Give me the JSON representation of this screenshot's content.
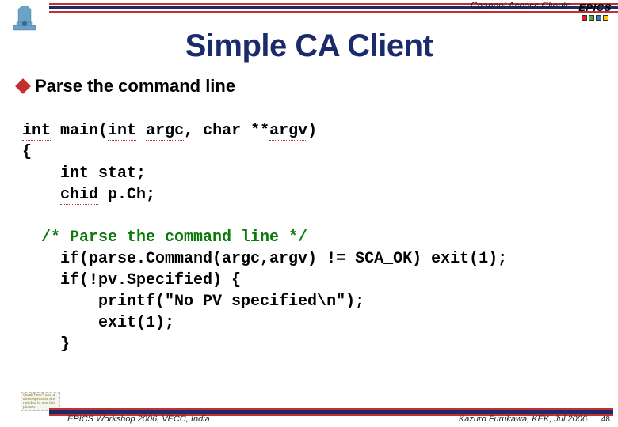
{
  "header": {
    "caption": "Channel Access Clients",
    "logo_text": "EPICS",
    "block_colors": [
      "#e41a1c",
      "#4daf4a",
      "#377eb8",
      "#ffcc00"
    ]
  },
  "title": "Simple CA Client",
  "bullet": "Parse the command line",
  "code": {
    "l1a": "int",
    "l1b": " main(",
    "l1c": "int",
    "l1d": " ",
    "l1e": "argc",
    "l1f": ", char **",
    "l1g": "argv",
    "l1h": ")",
    "l2": "{",
    "l3a": "    ",
    "l3b": "int",
    "l3c": " stat;",
    "l4a": "    ",
    "l4b": "chid",
    "l4c": " p.Ch;",
    "blank1": " ",
    "l5a": "  /* Parse the command line */",
    "l6": "    if(parse.Command(argc,argv) != SCA_OK) exit(1);",
    "l7": "    if(!pv.Specified) {",
    "l8": "        printf(\"No PV specified\\n\");",
    "l9": "        exit(1);",
    "l10": "    }"
  },
  "footer": {
    "left": "EPICS Workshop 2006, VECC, India",
    "right": "Kazuro Furukawa, KEK, Jul.2006.",
    "page": "48"
  },
  "placeholder_text": "QuickTime? and a decompressor are needed to see this picture."
}
